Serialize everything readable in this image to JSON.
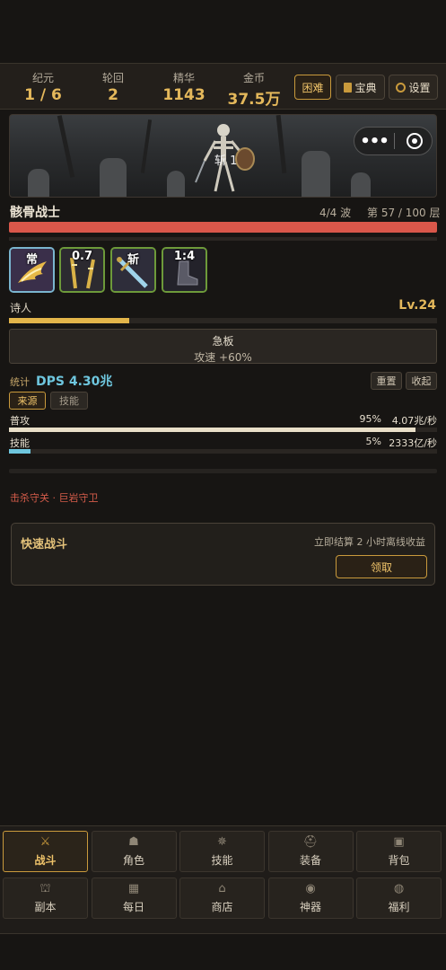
{
  "header": {
    "stats": [
      {
        "label": "纪元",
        "value": "1 / 6"
      },
      {
        "label": "轮回",
        "value": "2"
      },
      {
        "label": "精华",
        "value": "1143"
      },
      {
        "label": "金币",
        "value": "37.5万"
      }
    ],
    "buttons": {
      "difficulty": "困难",
      "codex": "宝典",
      "settings": "设置"
    }
  },
  "battle": {
    "hit_text": "斩 1",
    "enemy_name": "骸骨战士",
    "wave": "4/4 波",
    "layer": "第 57 / 100 层",
    "hp_fraction": 1.0
  },
  "skills": [
    {
      "tag": "常",
      "icon": "wing-icon"
    },
    {
      "tag": "0.7",
      "icon": "crossed-blades-icon"
    },
    {
      "tag": "斩",
      "icon": "sword-icon"
    },
    {
      "tag": "1:4",
      "icon": "boot-icon"
    }
  ],
  "character": {
    "class_name": "诗人",
    "level": "Lv.24",
    "xp_fraction": 0.28
  },
  "buff": {
    "title": "急板",
    "desc": "攻速 +60%"
  },
  "dps": {
    "label": "统计",
    "value": "DPS 4.30兆",
    "reset": "重置",
    "collapse": "收起",
    "tabs": [
      "来源",
      "技能"
    ],
    "rows": [
      {
        "name": "普攻",
        "percent": "95%",
        "amount": "4.07兆/秒",
        "fraction": 0.95,
        "color": "#e9dfc8"
      },
      {
        "name": "技能",
        "percent": "5%",
        "amount": "2333亿/秒",
        "fraction": 0.05,
        "color": "#6ec6de"
      }
    ]
  },
  "kill_objective": "击杀守关 · 巨岩守卫",
  "quick_fight": {
    "title": "快速战斗",
    "desc": "立即结算 2 小时离线收益",
    "button": "领取"
  },
  "nav": [
    {
      "label": "战斗",
      "icon": "crossed-swords-icon",
      "glyph": "⚔",
      "active": true
    },
    {
      "label": "角色",
      "icon": "person-icon",
      "glyph": "☗",
      "active": false
    },
    {
      "label": "技能",
      "icon": "spark-icon",
      "glyph": "✵",
      "active": false
    },
    {
      "label": "装备",
      "icon": "helmet-icon",
      "glyph": "⛑",
      "active": false
    },
    {
      "label": "背包",
      "icon": "bag-icon",
      "glyph": "▣",
      "active": false
    },
    {
      "label": "副本",
      "icon": "gate-icon",
      "glyph": "⛫",
      "active": false
    },
    {
      "label": "每日",
      "icon": "calendar-icon",
      "glyph": "▦",
      "active": false
    },
    {
      "label": "商店",
      "icon": "shop-icon",
      "glyph": "⌂",
      "active": false
    },
    {
      "label": "神器",
      "icon": "orb-icon",
      "glyph": "◉",
      "active": false
    },
    {
      "label": "福利",
      "icon": "gift-icon",
      "glyph": "◍",
      "active": false
    }
  ]
}
